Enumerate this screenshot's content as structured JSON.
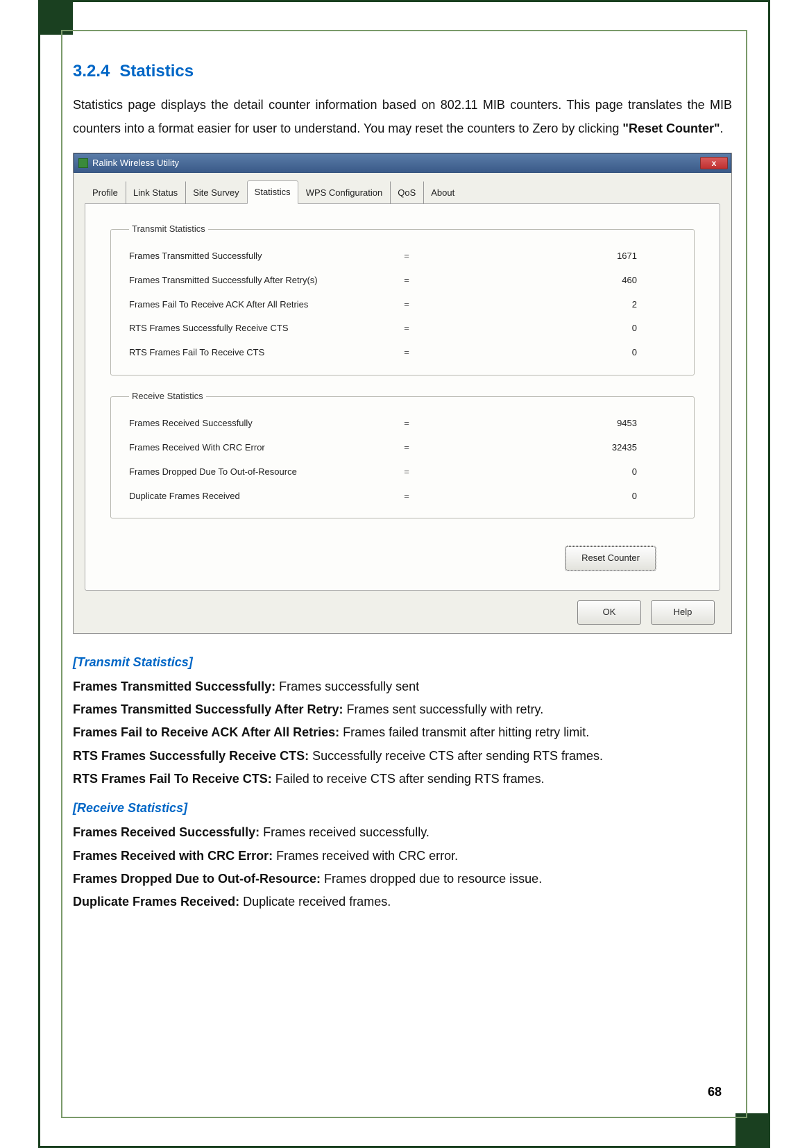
{
  "heading": {
    "number": "3.2.4",
    "title": "Statistics"
  },
  "intro": {
    "text_before": "Statistics page displays the detail counter information based on 802.11 MIB counters. This page translates the MIB counters into a format easier for user to understand. You may reset the counters to Zero by clicking ",
    "bold": "\"Reset Counter\"",
    "text_after": "."
  },
  "window": {
    "title": "Ralink Wireless Utility",
    "close": "x",
    "tabs": [
      "Profile",
      "Link Status",
      "Site Survey",
      "Statistics",
      "WPS Configuration",
      "QoS",
      "About"
    ],
    "active_tab_index": 3,
    "transmit_legend": "Transmit Statistics",
    "receive_legend": "Receive Statistics",
    "transmit": [
      {
        "label": "Frames Transmitted Successfully",
        "value": "1671"
      },
      {
        "label": "Frames Transmitted Successfully After Retry(s)",
        "value": "460"
      },
      {
        "label": "Frames Fail To Receive ACK After All Retries",
        "value": "2"
      },
      {
        "label": "RTS Frames Successfully Receive CTS",
        "value": "0"
      },
      {
        "label": "RTS Frames Fail To Receive CTS",
        "value": "0"
      }
    ],
    "receive": [
      {
        "label": "Frames Received Successfully",
        "value": "9453"
      },
      {
        "label": "Frames Received With CRC Error",
        "value": "32435"
      },
      {
        "label": "Frames Dropped Due To Out-of-Resource",
        "value": "0"
      },
      {
        "label": "Duplicate Frames Received",
        "value": "0"
      }
    ],
    "reset_label": "Reset Counter",
    "ok_label": "OK",
    "help_label": "Help"
  },
  "sections": {
    "transmit_heading": "[Transmit Statistics]",
    "receive_heading": "[Receive Statistics]"
  },
  "descriptions": {
    "transmit": [
      {
        "term": "Frames Transmitted Successfully: ",
        "def": "Frames successfully sent"
      },
      {
        "term": "Frames Transmitted Successfully After Retry: ",
        "def": "Frames sent successfully with retry."
      },
      {
        "term": "Frames Fail to Receive ACK After All Retries: ",
        "def": "Frames failed transmit after hitting retry limit."
      },
      {
        "term": "RTS Frames Successfully Receive CTS: ",
        "def": "Successfully receive CTS after sending RTS frames."
      },
      {
        "term": "RTS Frames Fail To Receive CTS: ",
        "def": "Failed to receive CTS after sending RTS frames."
      }
    ],
    "receive": [
      {
        "term": "Frames Received Successfully: ",
        "def": "Frames received successfully."
      },
      {
        "term": "Frames Received with CRC Error: ",
        "def": "Frames received with CRC error."
      },
      {
        "term": "Frames Dropped Due to Out-of-Resource: ",
        "def": "Frames dropped due to resource issue."
      },
      {
        "term": "Duplicate Frames Received: ",
        "def": "Duplicate received frames."
      }
    ]
  },
  "page_number": "68",
  "eq": "="
}
